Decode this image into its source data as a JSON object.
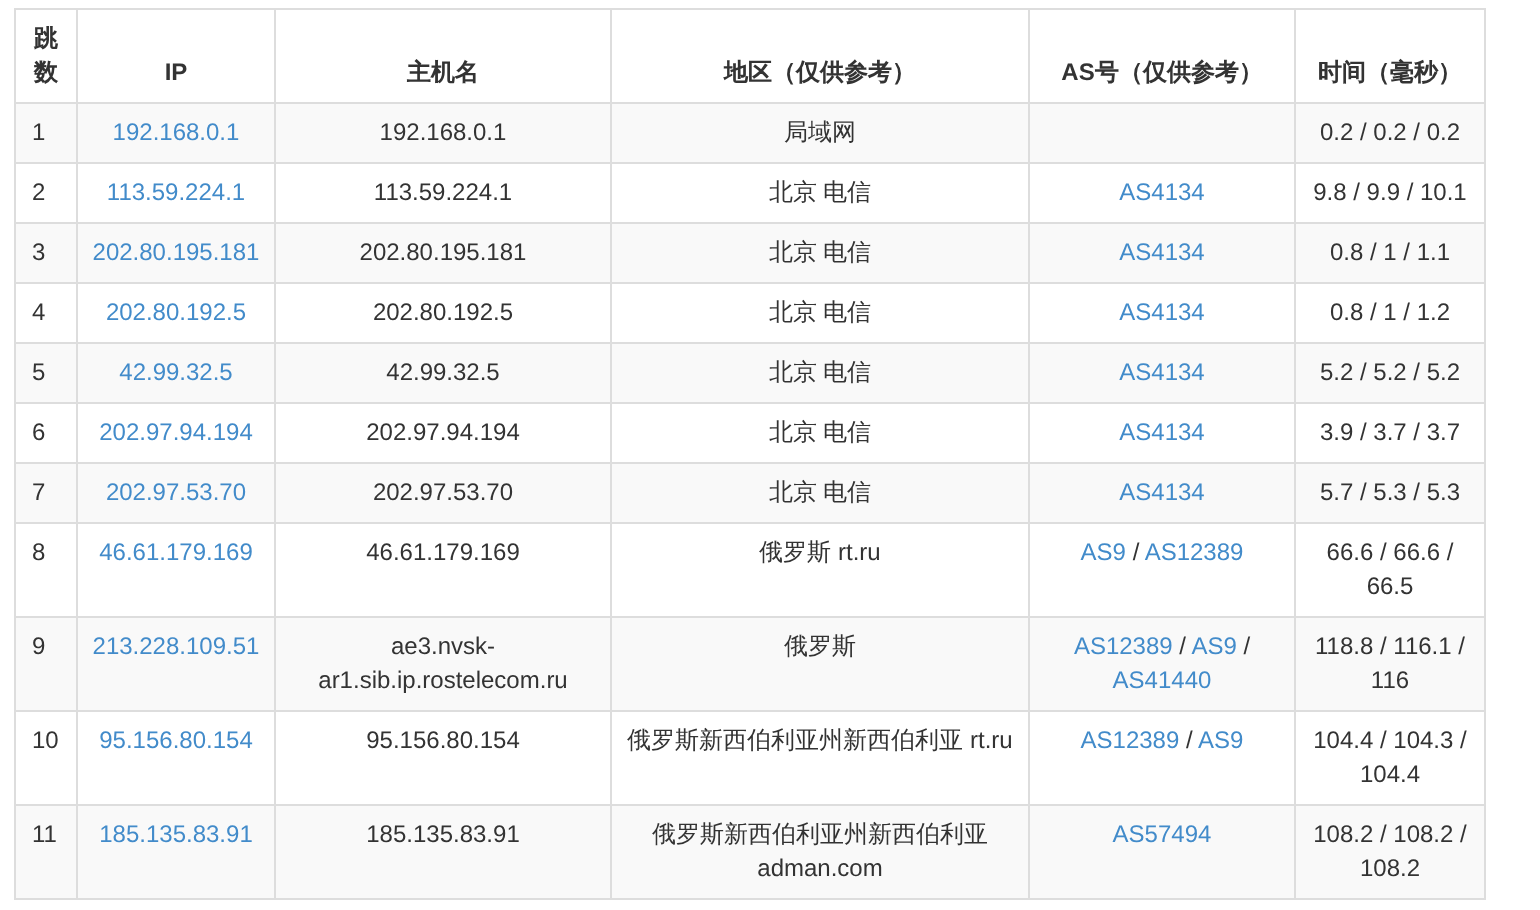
{
  "table": {
    "columns": [
      "跳数",
      "IP",
      "主机名",
      "地区（仅供参考）",
      "AS号（仅供参考）",
      "时间（毫秒）"
    ],
    "rows": [
      {
        "hop": "1",
        "ip": "192.168.0.1",
        "host": "192.168.0.1",
        "region": "局域网",
        "as": [],
        "time": "0.2 / 0.2 / 0.2"
      },
      {
        "hop": "2",
        "ip": "113.59.224.1",
        "host": "113.59.224.1",
        "region": "北京 电信",
        "as": [
          {
            "kind": "link",
            "text": "AS4134"
          }
        ],
        "time": "9.8 / 9.9 / 10.1"
      },
      {
        "hop": "3",
        "ip": "202.80.195.181",
        "host": "202.80.195.181",
        "region": "北京 电信",
        "as": [
          {
            "kind": "link",
            "text": "AS4134"
          }
        ],
        "time": "0.8 / 1 / 1.1"
      },
      {
        "hop": "4",
        "ip": "202.80.192.5",
        "host": "202.80.192.5",
        "region": "北京 电信",
        "as": [
          {
            "kind": "link",
            "text": "AS4134"
          }
        ],
        "time": "0.8 / 1 / 1.2"
      },
      {
        "hop": "5",
        "ip": "42.99.32.5",
        "host": "42.99.32.5",
        "region": "北京 电信",
        "as": [
          {
            "kind": "link",
            "text": "AS4134"
          }
        ],
        "time": "5.2 / 5.2 / 5.2"
      },
      {
        "hop": "6",
        "ip": "202.97.94.194",
        "host": "202.97.94.194",
        "region": "北京 电信",
        "as": [
          {
            "kind": "link",
            "text": "AS4134"
          }
        ],
        "time": "3.9 / 3.7 / 3.7"
      },
      {
        "hop": "7",
        "ip": "202.97.53.70",
        "host": "202.97.53.70",
        "region": "北京 电信",
        "as": [
          {
            "kind": "link",
            "text": "AS4134"
          }
        ],
        "time": "5.7 / 5.3 / 5.3"
      },
      {
        "hop": "8",
        "ip": "46.61.179.169",
        "host": "46.61.179.169",
        "region": "俄罗斯 rt.ru",
        "as": [
          {
            "kind": "link",
            "text": "AS9"
          },
          {
            "kind": "sep",
            "text": "/"
          },
          {
            "kind": "link",
            "text": "AS12389"
          }
        ],
        "time": "66.6 / 66.6 / 66.5"
      },
      {
        "hop": "9",
        "ip": "213.228.109.51",
        "host": "ae3.nvsk-ar1.sib.ip.rostelecom.ru",
        "region": "俄罗斯",
        "as": [
          {
            "kind": "link",
            "text": "AS12389"
          },
          {
            "kind": "sep",
            "text": "/"
          },
          {
            "kind": "link",
            "text": "AS9"
          },
          {
            "kind": "sep",
            "text": "/"
          },
          {
            "kind": "link",
            "text": "AS41440"
          }
        ],
        "time": "118.8 / 116.1 / 116"
      },
      {
        "hop": "10",
        "ip": "95.156.80.154",
        "host": "95.156.80.154",
        "region": "俄罗斯新西伯利亚州新西伯利亚 rt.ru",
        "as": [
          {
            "kind": "link",
            "text": "AS12389"
          },
          {
            "kind": "sep",
            "text": "/"
          },
          {
            "kind": "link",
            "text": "AS9"
          }
        ],
        "time": "104.4 / 104.3 / 104.4"
      },
      {
        "hop": "11",
        "ip": "185.135.83.91",
        "host": "185.135.83.91",
        "region": "俄罗斯新西伯利亚州新西伯利亚 adman.com",
        "as": [
          {
            "kind": "link",
            "text": "AS57494"
          }
        ],
        "time": "108.2 / 108.2 / 108.2"
      }
    ]
  }
}
